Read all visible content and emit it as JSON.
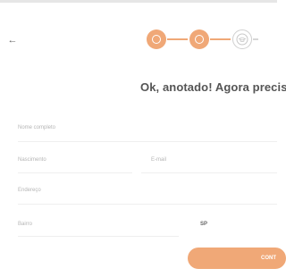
{
  "header": {
    "back_icon": "arrow-left-icon",
    "back_glyph": "←"
  },
  "stepper": {
    "steps": [
      {
        "state": "done",
        "icon": "circle-ring-icon"
      },
      {
        "state": "done",
        "icon": "circle-ring-icon"
      },
      {
        "state": "pending",
        "icon": "cap-icon"
      }
    ],
    "accent_color": "#f0a877"
  },
  "headline": "Ok, anotado! Agora precisai",
  "form": {
    "full_name_label": "Nome completo",
    "birth_label": "Nascimento",
    "email_label": "E-mail",
    "address_label": "Endereço",
    "district_label": "Bairro",
    "state_value": "SP"
  },
  "cta": {
    "label": "CONT",
    "color": "#f0a877"
  }
}
